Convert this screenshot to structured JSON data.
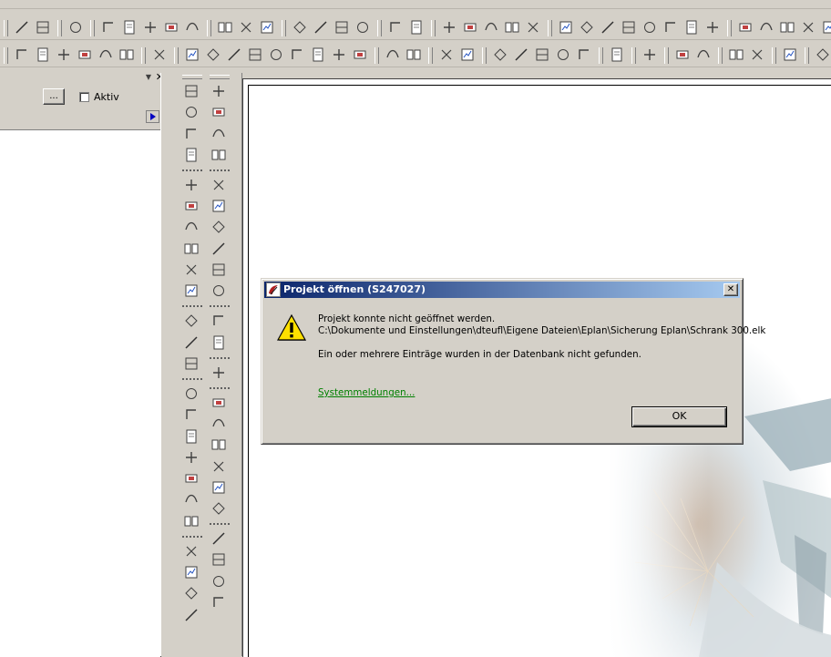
{
  "left_panel": {
    "browse_label": "...",
    "checkbox_label": "Aktiv"
  },
  "dialog": {
    "title": "Projekt öffnen (S247027)",
    "close_label": "✕",
    "message_line1": "Projekt konnte nicht geöffnet werden.",
    "message_line2": "C:\\Dokumente und Einstellungen\\dteufl\\Eigene Dateien\\Eplan\\Sicherung Eplan\\Schrank 300.elk",
    "message_line3": "Ein oder mehrere Einträge wurden in der Datenbank nicht gefunden.",
    "link_label": "Systemmeldungen...",
    "ok_label": "OK"
  },
  "colors": {
    "title_gradient_start": "#0a246a",
    "title_gradient_end": "#a6caf0",
    "link": "#008000",
    "face": "#d4d0c8"
  },
  "icons": {
    "dialog_icon": "eplan-app-icon",
    "message_icon": "warning-icon"
  }
}
